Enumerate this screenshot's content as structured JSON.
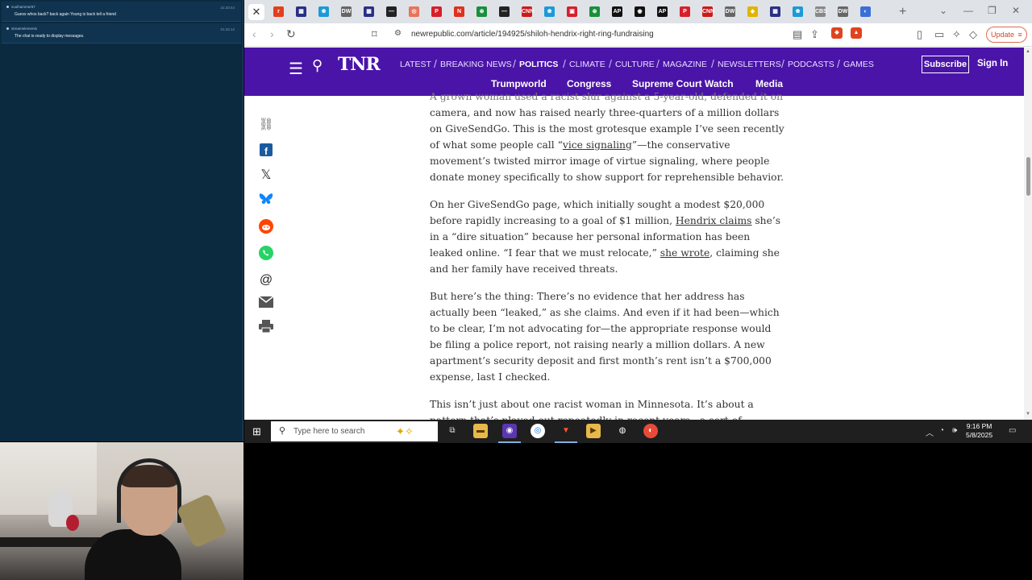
{
  "chat": {
    "messages": [
      {
        "user": "soulhammer87",
        "time": "21:33:44",
        "text": "Guess whos back? back again Young is back tell a friend"
      },
      {
        "user": "streamelements",
        "time": "21:34:12",
        "text": "The chat is ready to display messages."
      }
    ]
  },
  "browser": {
    "url": "newrepublic.com/article/194925/shiloh-hendrix-right-ring-fundraising",
    "update_label": "Update",
    "tab_close": "✕",
    "tab_favicons": [
      {
        "color": "#e2401c",
        "text": "r"
      },
      {
        "color": "#2a2f86",
        "text": "▦"
      },
      {
        "color": "#1c9ad6",
        "text": "❀"
      },
      {
        "color": "#666666",
        "text": "DW"
      },
      {
        "color": "#2a2f86",
        "text": "▦"
      },
      {
        "color": "#222222",
        "text": "—"
      },
      {
        "color": "#e8745b",
        "text": "◎"
      },
      {
        "color": "#d61f2b",
        "text": "P"
      },
      {
        "color": "#e0301e",
        "text": "N"
      },
      {
        "color": "#1a8f3c",
        "text": "⊛"
      },
      {
        "color": "#222222",
        "text": "—"
      },
      {
        "color": "#cc1a1a",
        "text": "CNN"
      },
      {
        "color": "#1c9ad6",
        "text": "❀"
      },
      {
        "color": "#d61f2b",
        "text": "▣"
      },
      {
        "color": "#1a8f3c",
        "text": "⊛"
      },
      {
        "color": "#111111",
        "text": "AP"
      },
      {
        "color": "#111111",
        "text": "◉"
      },
      {
        "color": "#111111",
        "text": "AP"
      },
      {
        "color": "#d61f2b",
        "text": "P"
      },
      {
        "color": "#cc1a1a",
        "text": "CNN"
      },
      {
        "color": "#666666",
        "text": "DW"
      },
      {
        "color": "#e0b400",
        "text": "◈"
      },
      {
        "color": "#2a2f86",
        "text": "▦"
      },
      {
        "color": "#1c9ad6",
        "text": "❀"
      },
      {
        "color": "#888888",
        "text": "CBS"
      },
      {
        "color": "#666666",
        "text": "DW"
      },
      {
        "color": "#3a6fd8",
        "text": "◐"
      }
    ]
  },
  "tnr": {
    "logo": "TNR",
    "nav": [
      {
        "label": "LATEST",
        "active": false
      },
      {
        "label": "BREAKING NEWS",
        "active": false
      },
      {
        "label": "POLITICS",
        "active": true
      },
      {
        "label": "CLIMATE",
        "active": false
      },
      {
        "label": "CULTURE",
        "active": false
      },
      {
        "label": "MAGAZINE",
        "active": false
      },
      {
        "label": "NEWSLETTERS",
        "active": false
      },
      {
        "label": "PODCASTS",
        "active": false
      },
      {
        "label": "GAMES",
        "active": false
      }
    ],
    "subnav": [
      "Trumpworld",
      "Congress",
      "Supreme Court Watch",
      "Media"
    ],
    "subscribe": "Subscribe",
    "signin": "Sign In"
  },
  "share_icons": [
    "link-icon",
    "facebook-icon",
    "x-icon",
    "bluesky-icon",
    "reddit-icon",
    "whatsapp-icon",
    "threads-icon",
    "email-icon",
    "print-icon"
  ],
  "article": {
    "p0_faded": "A grown woman used a racist slur against a 5-year-old, defended it on",
    "p0": {
      "a": "camera, and now has raised nearly three-quarters of a million dollars on GiveSendGo. This is the most grotesque example I’ve seen recently of what some people call “",
      "link": "vice signaling",
      "b": "”—the conservative movement’s twisted mirror image of virtue signaling, where people donate money specifically to show support for reprehensible behavior."
    },
    "p1": {
      "a": "On her GiveSendGo page, which initially sought a modest $20,000 before rapidly increasing to a goal of $1 million, ",
      "link1": "Hendrix claims",
      "b": " she’s in a “dire situation” because her personal information has been leaked online. “I fear that we must relocate,” ",
      "link2": "she wrote",
      "c": ", claiming she and her family have received threats."
    },
    "p2": "But here’s the thing: There’s no evidence that her address has actually been “leaked,” as she claims. And even if it had been—which to be clear, I’m not advocating for—the appropriate response would be filing a police report, not raising nearly a million dollars. A new apartment’s security deposit and first month’s rent isn’t a $700,000 expense, last I checked.",
    "p3": "This isn’t just about one racist woman in Minnesota. It’s about a pattern that’s played out repeatedly in recent years—a sort of patronage system for bigotry that’s become embedded in conservative fundraising culture."
  },
  "taskbar": {
    "search_placeholder": "Type here to search",
    "time": "9:16 PM",
    "date": "5/8/2025"
  }
}
